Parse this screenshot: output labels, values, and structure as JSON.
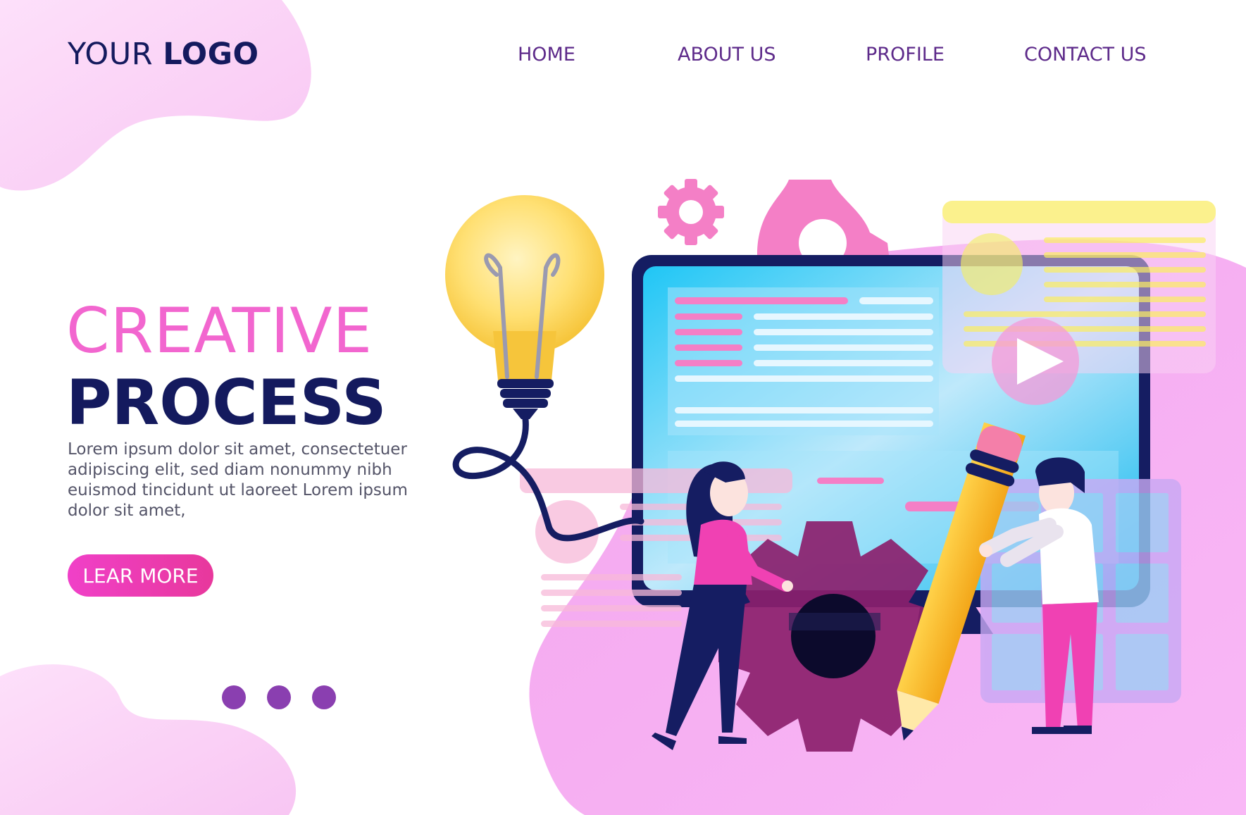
{
  "header": {
    "logo_light": "YOUR",
    "logo_bold": "LOGO",
    "nav": [
      {
        "label": "HOME"
      },
      {
        "label": "ABOUT US"
      },
      {
        "label": "PROFILE"
      },
      {
        "label": "CONTACT US"
      }
    ]
  },
  "hero": {
    "title_line1": "CREATIVE",
    "title_line2": "PROCESS",
    "body": "Lorem ipsum dolor sit amet, consectetuer adipiscing elit, sed diam nonummy nibh euismod tincidunt ut laoreet Lorem ipsum dolor sit amet,",
    "button_label": "LEAR MORE"
  },
  "slider": {
    "dot_count": 3,
    "active_index": 0
  },
  "colors": {
    "accent_pink": "#f266cf",
    "navy": "#141a5e",
    "nav_purple": "#5d2a8a",
    "button": "#ee3cbc",
    "dot": "#8a3fb0"
  },
  "illustration": {
    "icons": [
      "lightbulb-icon",
      "gear-icon",
      "monitor-icon",
      "pencil-icon",
      "play-icon"
    ]
  }
}
